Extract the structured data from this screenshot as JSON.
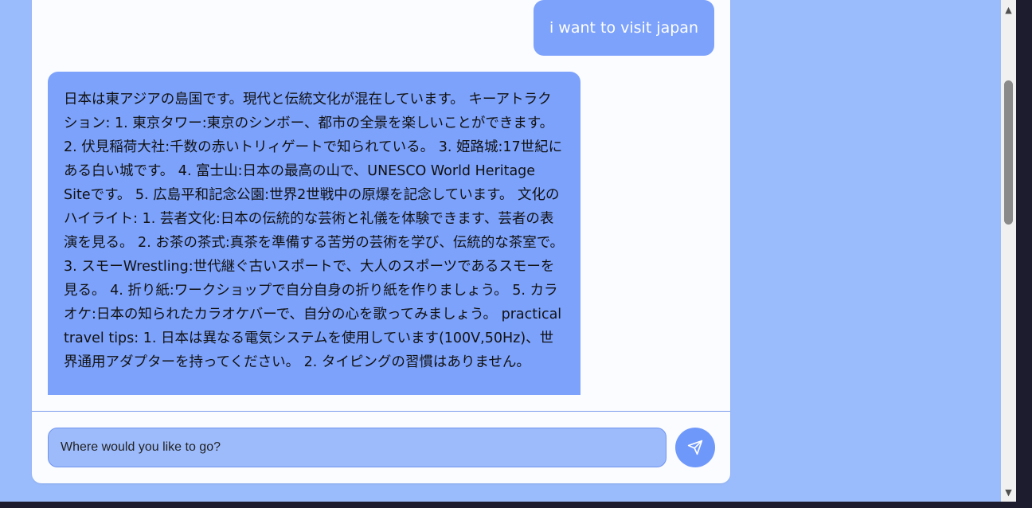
{
  "chat": {
    "user_message": "i want to visit japan",
    "bot_message": "日本は東アジアの島国です。現代と伝統文化が混在しています。 キーアトラクション: 1. 東京タワー:東京のシンボー、都市の全景を楽しいことができます。 2. 伏見稲荷大社:千数の赤いトリィゲートで知られている。 3. 姫路城:17世紀にある白い城です。 4. 富士山:日本の最高の山で、UNESCO World Heritage Siteです。 5. 広島平和記念公園:世界2世戦中の原爆を記念しています。 文化のハイライト: 1. 芸者文化:日本の伝統的な芸術と礼儀を体験できます、芸者の表演を見る。 2. お茶の茶式:真茶を準備する苦労の芸術を学び、伝統的な茶室で。 3. スモーWrestling:世代継ぐ古いスポートで、大人のスポーツであるスモーを見る。 4. 折り紙:ワークショップで自分自身の折り紙を作りましょう。 5. カラオケ:日本の知られたカラオケバーで、自分の心を歌ってみましょう。 practical travel tips: 1. 日本は異なる電気システムを使用しています(100V,50Hz)、世界通用アダプターを持ってください。 2. タイピングの習慣はありません。"
  },
  "composer": {
    "placeholder": "Where would you like to go?",
    "value": "",
    "send_icon": "send-icon"
  },
  "scrollbar": {
    "up_arrow": "▲",
    "down_arrow": "▼"
  },
  "colors": {
    "page_background": "#9bbcfc",
    "panel_background": "#fbfcff",
    "bubble": "#7da2fb",
    "send_button": "#6f98fb"
  }
}
